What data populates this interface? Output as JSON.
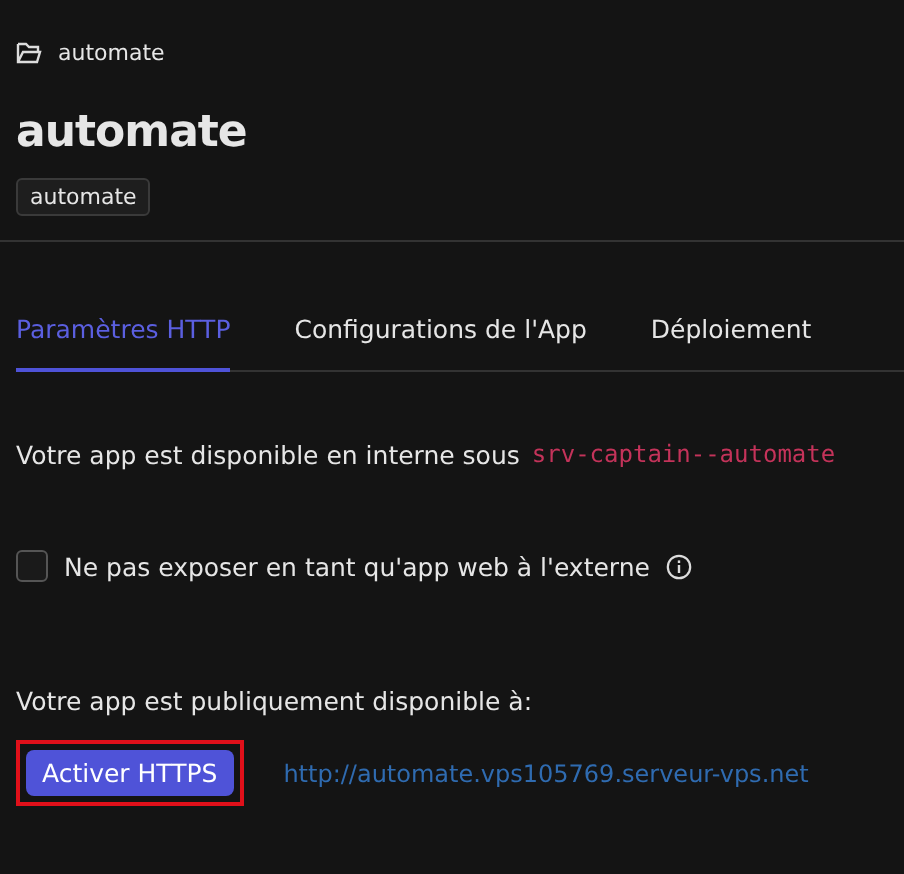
{
  "breadcrumb": {
    "label": "automate"
  },
  "title": "automate",
  "tag": "automate",
  "tabs": [
    {
      "label": "Paramètres HTTP",
      "selected": true
    },
    {
      "label": "Configurations de l'App",
      "selected": false
    },
    {
      "label": "Déploiement",
      "selected": false
    }
  ],
  "internal": {
    "text": "Votre app est disponible en interne sous",
    "code": "srv-captain--automate"
  },
  "expose_checkbox": {
    "label": "Ne pas exposer en tant qu'app web à l'externe",
    "checked": false
  },
  "public": {
    "text": "Votre app est publiquement disponible à:",
    "button": "Activer HTTPS",
    "highlighted": true,
    "url": "http://automate.vps105769.serveur-vps.net"
  }
}
